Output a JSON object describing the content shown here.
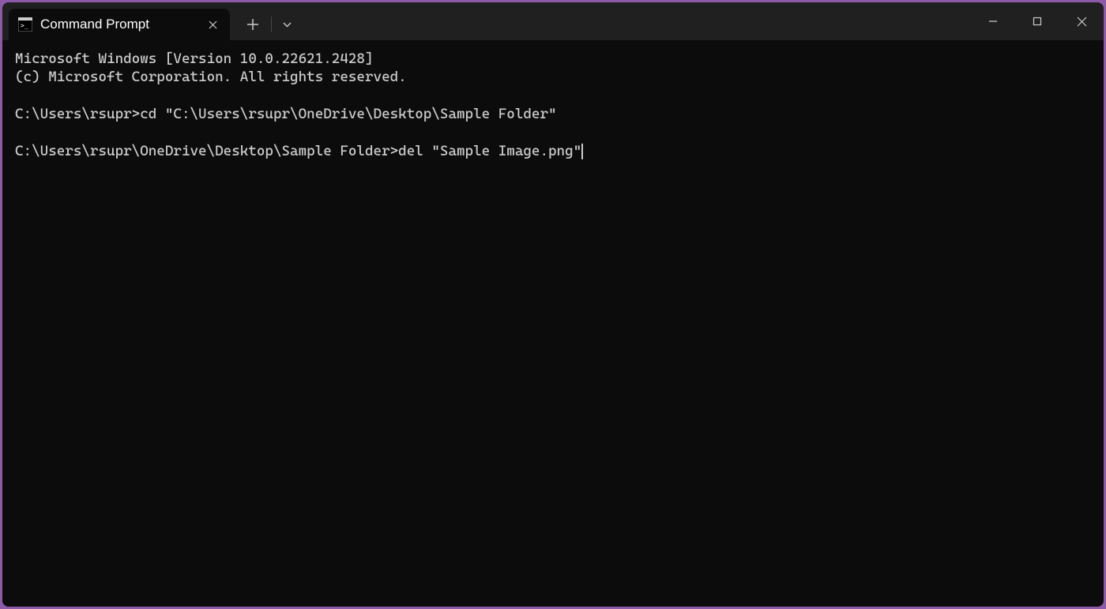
{
  "titlebar": {
    "tab_title": "Command Prompt"
  },
  "terminal": {
    "header_line1": "Microsoft Windows [Version 10.0.22621.2428]",
    "header_line2": "(c) Microsoft Corporation. All rights reserved.",
    "blank1": "",
    "prompt1": "C:\\Users\\rsupr>",
    "command1": "cd \"C:\\Users\\rsupr\\OneDrive\\Desktop\\Sample Folder\"",
    "blank2": "",
    "prompt2": "C:\\Users\\rsupr\\OneDrive\\Desktop\\Sample Folder>",
    "command2": "del \"Sample Image.png\""
  }
}
